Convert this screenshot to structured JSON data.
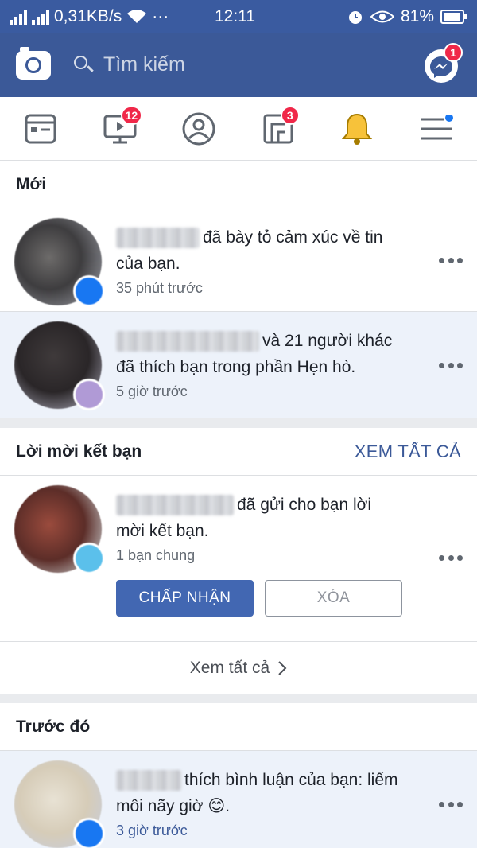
{
  "status_bar": {
    "network_speed": "0,31KB/s",
    "dots": "···",
    "time": "12:11",
    "battery": "81%"
  },
  "header": {
    "search_placeholder": "Tìm kiếm",
    "messenger_badge": "1"
  },
  "nav": {
    "watch_badge": "12",
    "marketplace_badge": "3"
  },
  "sections": {
    "new": {
      "title": "Mới",
      "items": [
        {
          "text": "đã bày tỏ cảm xúc về tin của bạn.",
          "time": "35 phút trước"
        },
        {
          "text": "và 21 người khác đã thích bạn trong phần Hẹn hò.",
          "time": "5 giờ trước"
        }
      ]
    },
    "friend_requests": {
      "title": "Lời mời kết bạn",
      "see_all": "XEM TẤT CẢ",
      "item": {
        "text": "đã gửi cho bạn lời mời kết bạn.",
        "mutual": "1 bạn chung",
        "accept": "CHẤP NHẬN",
        "delete": "XÓA"
      },
      "footer": "Xem tất cả"
    },
    "earlier": {
      "title": "Trước đó",
      "item": {
        "text": "thích bình luận của bạn: liếm môi nãy giờ 😊.",
        "time": "3 giờ trước"
      }
    }
  },
  "colors": {
    "brand": "#3b5998",
    "badge": "#f02849",
    "unread_bg": "#edf2fa"
  }
}
